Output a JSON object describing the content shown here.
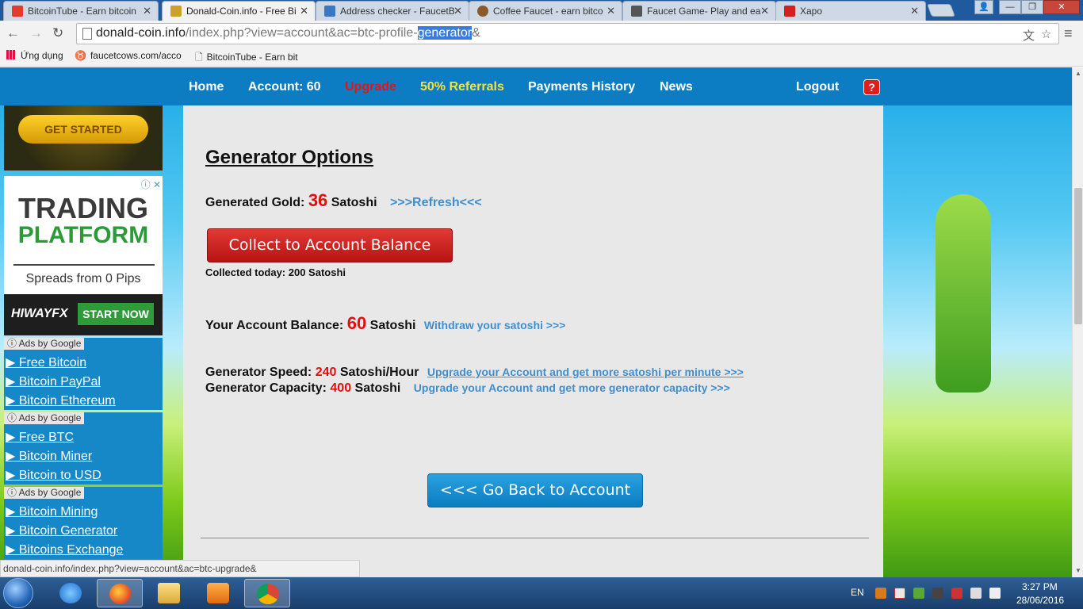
{
  "browser": {
    "tabs": [
      {
        "label": "BitcoinTube - Earn bitcoin",
        "active": false,
        "favicon_color": "#e33b2e"
      },
      {
        "label": "Donald-Coin.info - Free Bi",
        "active": true,
        "favicon_color": "#c9a227"
      },
      {
        "label": "Address checker - FaucetB",
        "active": false,
        "favicon_color": "#3b78c2"
      },
      {
        "label": "Coffee Faucet - earn bitco",
        "active": false,
        "favicon_color": "#8a5a2b"
      },
      {
        "label": "Faucet Game- Play and ea",
        "active": false,
        "favicon_color": "#555555"
      },
      {
        "label": "Xapo",
        "active": false,
        "favicon_color": "#d32020"
      }
    ],
    "tab_close_glyph": "✕",
    "window_buttons": {
      "user": "👤",
      "minimize": "—",
      "maximize": "❐",
      "close": "✕"
    },
    "nav": {
      "back": "←",
      "forward": "→",
      "reload": "↻"
    },
    "url": {
      "host": "donald-coin.info",
      "before_sel": "/index.php?view=account&ac=btc-profile-",
      "selected": "generator",
      "after_sel": "&"
    },
    "omnibox_icons": {
      "translate": "文",
      "star": "☆"
    },
    "menu": "≡",
    "bookmarks": [
      {
        "label": "Ứng dụng",
        "icon": "apps-icon"
      },
      {
        "label": "faucetcows.com/acco",
        "icon": "cow-icon",
        "glyph": "♉"
      },
      {
        "label": "BitcoinTube - Earn bit",
        "icon": "page-icon",
        "glyph": "🗋"
      }
    ],
    "status_url": "donald-coin.info/index.php?view=account&ac=btc-upgrade&"
  },
  "site_nav": [
    {
      "label": "Home",
      "color": "#ffffff"
    },
    {
      "label": "Account: 60",
      "color": "#ffffff"
    },
    {
      "label": "Upgrade",
      "color": "#e8121a"
    },
    {
      "label": "50% Referrals",
      "color": "#f5e23b"
    },
    {
      "label": "Payments History",
      "color": "#ffffff"
    },
    {
      "label": "News",
      "color": "#ffffff"
    },
    {
      "label": "Logout",
      "color": "#ffffff"
    }
  ],
  "help_label": "?",
  "main": {
    "heading": "Generator Options",
    "generated": {
      "label": "Generated Gold:",
      "value": "36",
      "unit": "Satoshi",
      "refresh": ">>>Refresh<<<"
    },
    "collect_button": "Collect to Account Balance",
    "collected_today": "Collected today: 200 Satoshi",
    "balance": {
      "label": "Your Account Balance:",
      "value": "60",
      "unit": "Satoshi",
      "link": "Withdraw your satoshi >>>"
    },
    "speed": {
      "label": "Generator Speed:",
      "value": "240",
      "unit": "Satoshi/Hour",
      "link": "Upgrade your Account and get more satoshi per minute >>>"
    },
    "capacity": {
      "label": "Generator Capacity:",
      "value": "400",
      "unit": "Satoshi",
      "link": "Upgrade your Account and get more generator capacity >>>"
    },
    "back_button": "<<< Go Back to Account"
  },
  "ads": {
    "get_started": "GET STARTED",
    "trading_line1": "TRADING",
    "trading_line2": "PLATFORM",
    "spreads": "Spreads from 0 Pips",
    "brand": "HIWAYFX",
    "start_now": "START NOW",
    "ad_choices": "ⓘ ✕",
    "ads_by": "ⓘ Ads by Google",
    "link_groups": [
      [
        "▶ Free Bitcoin",
        "▶ Bitcoin PayPal",
        "▶ Bitcoin Ethereum"
      ],
      [
        "▶ Free BTC",
        "▶ Bitcoin Miner",
        "▶ Bitcoin to USD"
      ],
      [
        "▶ Bitcoin Mining",
        "▶ Bitcoin Generator",
        "▶ Bitcoins Exchange"
      ]
    ]
  },
  "taskbar": {
    "language": "EN",
    "time": "3:27 PM",
    "date": "28/06/2016"
  }
}
